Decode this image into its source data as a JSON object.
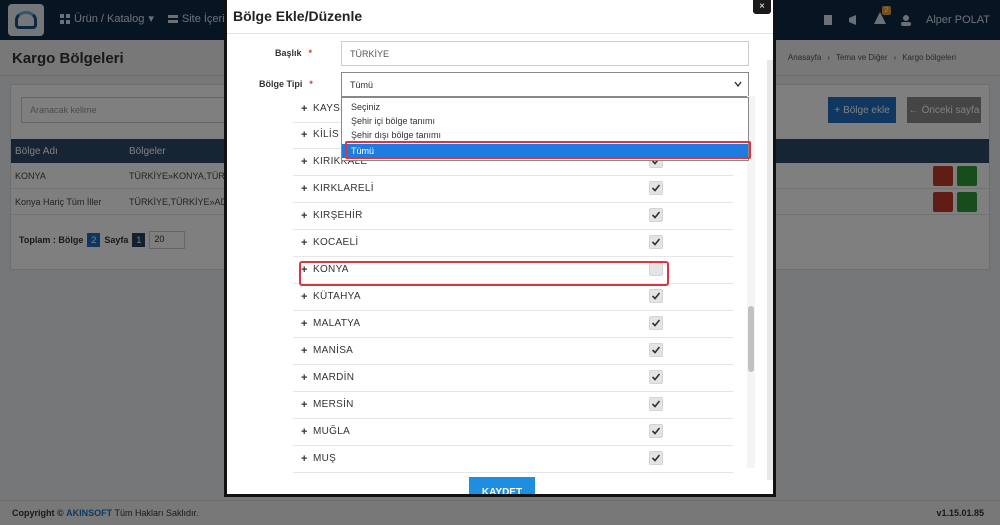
{
  "topbar": {
    "nav": [
      {
        "label": "Ürün / Katalog",
        "icon": "grid-icon"
      },
      {
        "label": "Site İçerikleri",
        "icon": "layers-icon"
      }
    ],
    "user": "Alper POLAT",
    "notification_count": "2"
  },
  "page": {
    "title": "Kargo Bölgeleri",
    "breadcrumb": [
      "Anasayfa",
      "Tema ve Diğer",
      "Kargo bölgeleri"
    ]
  },
  "list": {
    "search_placeholder": "Aranacak kelime",
    "add_button": "Bölge ekle",
    "back_button": "Önceki sayfa",
    "columns": [
      "Bölge Adı",
      "Bölgeler"
    ],
    "rows": [
      {
        "name": "KONYA",
        "regions": "TÜRKİYE»KONYA,TÜRK"
      },
      {
        "name": "Konya Hariç Tüm İller",
        "regions": "TÜRKİYE,TÜRKİYE»ADI"
      }
    ],
    "pager": {
      "total_label": "Toplam : Bölge",
      "total": "2",
      "page_label": "Sayfa",
      "page": "1",
      "page_size": "20"
    }
  },
  "footer": {
    "copyright": "Copyright ©",
    "brand": "AKINSOFT",
    "rights": "Tüm Hakları Saklıdır.",
    "version": "v1.15.01.85"
  },
  "modal": {
    "title": "Bölge Ekle/Düzenle",
    "close": "×",
    "title_label": "Başlık",
    "title_value": "TÜRKİYE",
    "type_label": "Bölge Tipi",
    "type_value": "Tümü",
    "required_mark": "*",
    "options": [
      {
        "label": "Seçiniz",
        "selected": false
      },
      {
        "label": "Şehir içi bölge tanımı",
        "selected": false
      },
      {
        "label": "Şehir dışı bölge tanımı",
        "selected": false
      },
      {
        "label": "Tümü",
        "selected": true
      }
    ],
    "regions": [
      {
        "name": "KAYSERİ",
        "checked": true
      },
      {
        "name": "KİLİS",
        "checked": true
      },
      {
        "name": "KIRIKKALE",
        "checked": true
      },
      {
        "name": "KIRKLARELİ",
        "checked": true
      },
      {
        "name": "KIRŞEHİR",
        "checked": true
      },
      {
        "name": "KOCAELİ",
        "checked": true
      },
      {
        "name": "KONYA",
        "checked": false
      },
      {
        "name": "KÜTAHYA",
        "checked": true
      },
      {
        "name": "MALATYA",
        "checked": true
      },
      {
        "name": "MANİSA",
        "checked": true
      },
      {
        "name": "MARDİN",
        "checked": true
      },
      {
        "name": "MERSİN",
        "checked": true
      },
      {
        "name": "MUĞLA",
        "checked": true
      },
      {
        "name": "MUŞ",
        "checked": true
      }
    ],
    "save_button": "KAYDET"
  }
}
